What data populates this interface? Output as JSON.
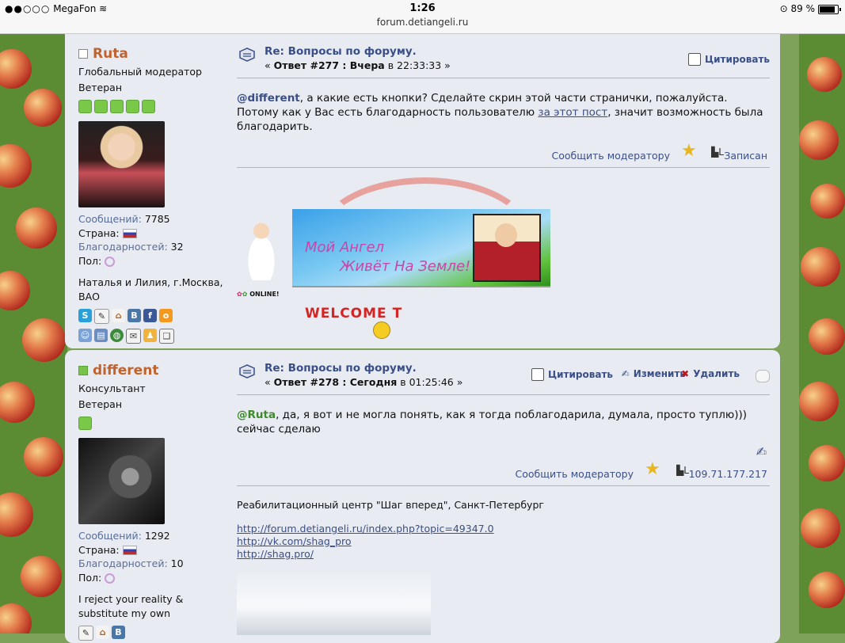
{
  "status_bar": {
    "carrier": "MegaFon",
    "time": "1:26",
    "battery": "89 %",
    "url": "forum.detiangeli.ru"
  },
  "posts": [
    {
      "author": "Ruta",
      "online": false,
      "rank": "Глобальный модератор",
      "title": "Ветеран",
      "stats": {
        "messages_label": "Сообщений:",
        "messages": "7785",
        "country_label": "Страна:",
        "thanks_label": "Благодарностей:",
        "thanks": "32",
        "gender_label": "Пол:"
      },
      "bio": "Наталья и Лилия, г.Москва, ВАО",
      "topic": "Re: Вопросы по форуму.",
      "reply_prefix": "« ",
      "reply_no": "Ответ #277 : Вчера",
      "reply_time": " в 22:33:33 »",
      "buttons": {
        "quote": "Цитировать"
      },
      "body": {
        "mention": "@different",
        "text1": ",  а какие есть кнопки? Сделайте скрин этой части странички, пожалуйста.",
        "text2": "Потому как у Вас есть благодарность пользователю ",
        "link": "за этот пост",
        "text3": ", значит возможность была благодарить."
      },
      "report": "Сообщить модератору",
      "ip_label": "Записан",
      "signature": {
        "banner_line1": "Мой Ангел",
        "banner_line2": "Живёт На Земле!",
        "online": "ONLINE!",
        "welcome": "WELCOME T"
      }
    },
    {
      "author": "different",
      "online": true,
      "rank": "Консультант",
      "title": "Ветеран",
      "stats": {
        "messages_label": "Сообщений:",
        "messages": "1292",
        "country_label": "Страна:",
        "thanks_label": "Благодарностей:",
        "thanks": "10",
        "gender_label": "Пол:"
      },
      "bio": "I reject your reality & substitute my own",
      "topic": "Re: Вопросы по форуму.",
      "reply_prefix": "« ",
      "reply_no": "Ответ #278 : Сегодня",
      "reply_time": " в 01:25:46 »",
      "buttons": {
        "quote": "Цитировать",
        "edit": "Изменить",
        "delete": "Удалить"
      },
      "body": {
        "mention": "@Ruta",
        "text1": ", да, я вот и не могла понять, как я тогда поблагодарила, думала, просто туплю)))",
        "text2": "сейчас сделаю"
      },
      "report": "Сообщить модератору",
      "ip": "109.71.177.217",
      "signature": {
        "line": "Реабилитационный центр \"Шаг вперед\", Санкт-Петербург",
        "links": [
          "http://forum.detiangeli.ru/index.php?topic=49347.0",
          "http://vk.com/shag_pro",
          "http://shag.pro/"
        ]
      }
    }
  ]
}
